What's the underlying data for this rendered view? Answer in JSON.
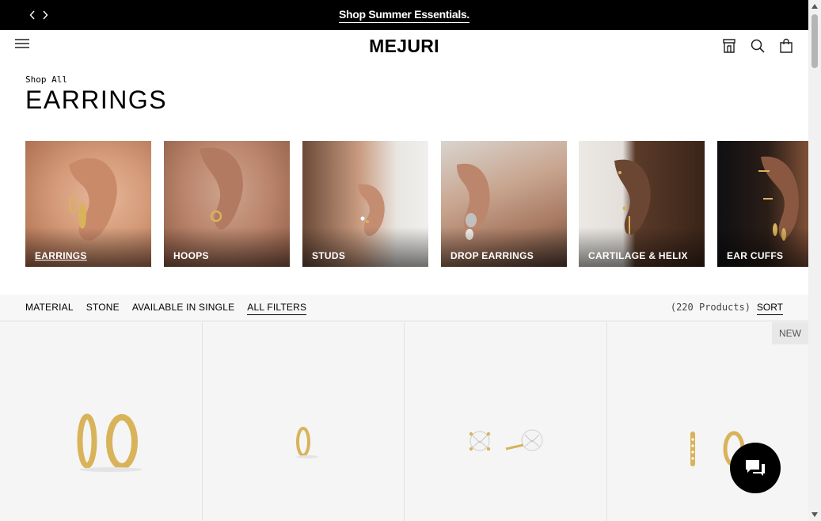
{
  "promo": {
    "text": "Shop Summer Essentials.",
    "prev_icon": "chevron-left-icon",
    "next_icon": "chevron-right-icon"
  },
  "header": {
    "logo": "MEJURI",
    "menu_icon": "hamburger-menu-icon",
    "icons": [
      "store-icon",
      "search-icon",
      "shopping-bag-icon"
    ]
  },
  "breadcrumb": "Shop All",
  "page_title": "EARRINGS",
  "categories": [
    {
      "label": "EARRINGS",
      "active": true
    },
    {
      "label": "HOOPS",
      "active": false
    },
    {
      "label": "STUDS",
      "active": false
    },
    {
      "label": "DROP EARRINGS",
      "active": false
    },
    {
      "label": "CARTILAGE & HELIX",
      "active": false
    },
    {
      "label": "EAR CUFFS",
      "active": false
    }
  ],
  "filters": {
    "items": [
      "MATERIAL",
      "STONE",
      "AVAILABLE IN SINGLE",
      "ALL FILTERS"
    ],
    "count": "(220 Products)",
    "sort": "SORT"
  },
  "products": [
    {
      "image": "gold-huggie-hoops",
      "badge": ""
    },
    {
      "image": "gold-mini-hoop",
      "badge": ""
    },
    {
      "image": "diamond-stud-earrings",
      "badge": ""
    },
    {
      "image": "pave-bar-and-hoop-earrings",
      "badge": "NEW"
    }
  ],
  "chat": {
    "icon": "chat-bubble-icon"
  },
  "colors": {
    "promo_bg": "#000000",
    "page_bg": "#ffffff",
    "filter_bg": "#f7f7f7",
    "tile_bg": "#f5f5f5",
    "gold": "#d9b35a"
  }
}
